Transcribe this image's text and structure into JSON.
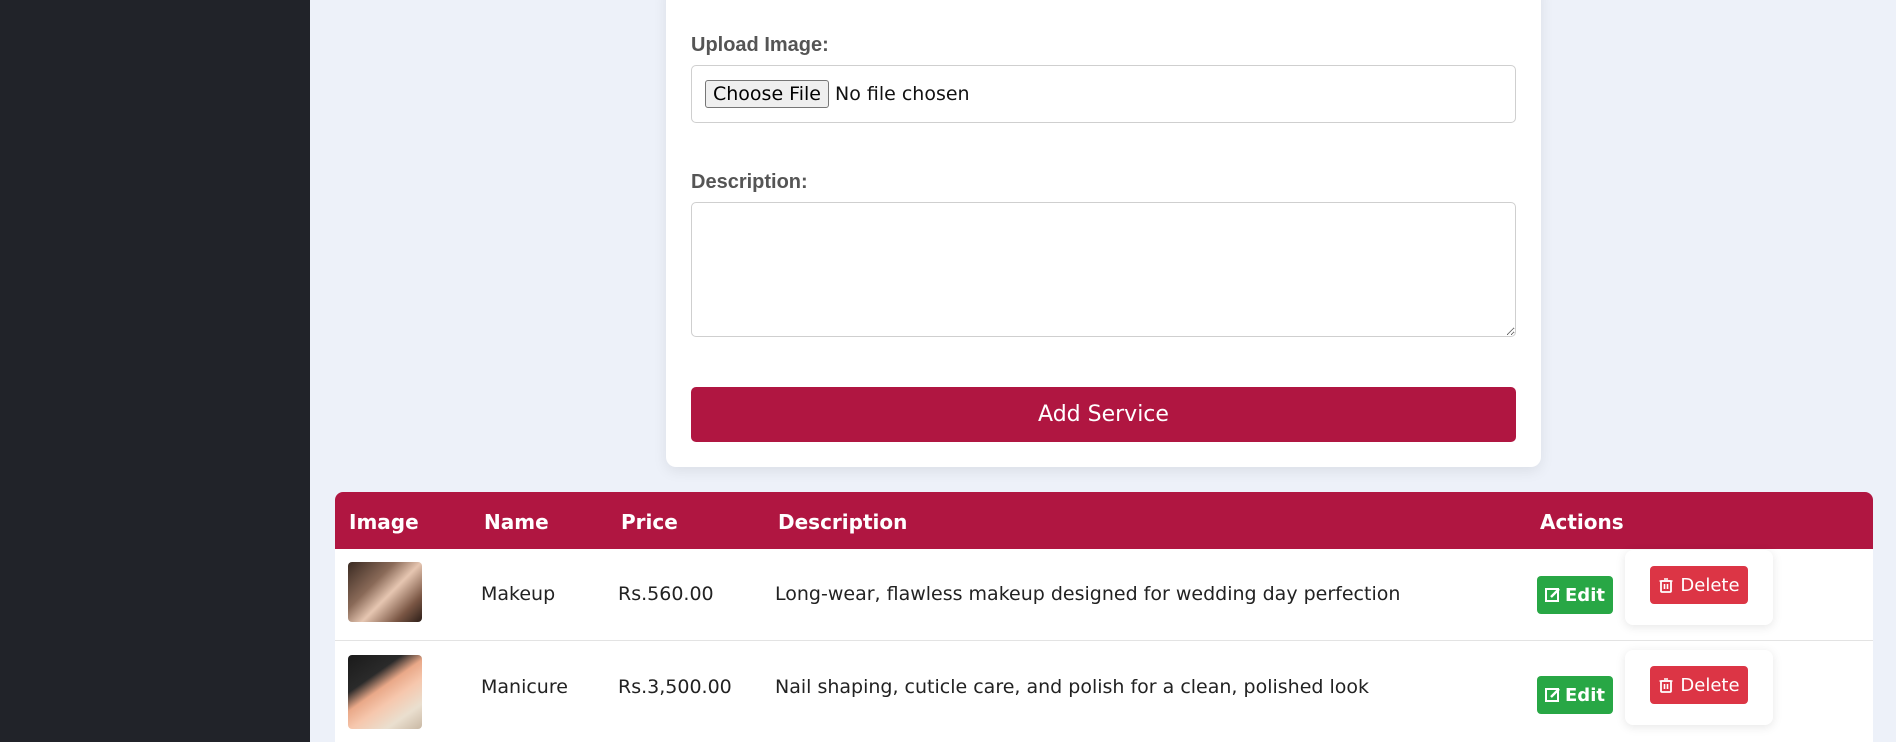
{
  "form": {
    "upload_label": "Upload Image:",
    "choose_file_label": "Choose File",
    "file_status": "No file chosen",
    "description_label": "Description:",
    "description_value": "",
    "submit_label": "Add Service"
  },
  "table": {
    "columns": [
      "Image",
      "Name",
      "Price",
      "Description",
      "Actions"
    ],
    "rows": [
      {
        "image": "makeup-thumbnail",
        "name": "Makeup",
        "price": "Rs.560.00",
        "description": "Long-wear, flawless makeup designed for wedding day perfection",
        "edit_label": "Edit",
        "delete_label": "Delete"
      },
      {
        "image": "manicure-thumbnail",
        "name": "Manicure",
        "price": "Rs.3,500.00",
        "description": "Nail shaping, cuticle care, and polish for a clean, polished look",
        "edit_label": "Edit",
        "delete_label": "Delete"
      }
    ]
  },
  "icons": {
    "edit": "edit-icon",
    "delete": "trash-icon"
  },
  "colors": {
    "sidebar": "#212329",
    "page_bg": "#edf1f9",
    "primary": "#b01641",
    "edit": "#28a745",
    "delete": "#dc3545"
  }
}
